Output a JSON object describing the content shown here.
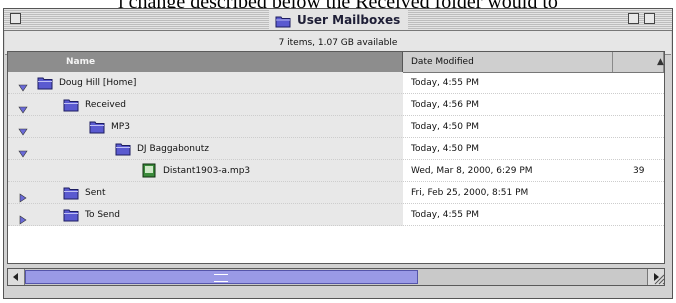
{
  "caption": "l change described below the Received folder would to",
  "window": {
    "title": "User Mailboxes"
  },
  "status": {
    "text": "7 items, 1.07 GB available"
  },
  "columns": {
    "name": "Name",
    "date": "Date Modified"
  },
  "rows": [
    {
      "label": "Doug Hill [Home]",
      "date": "Today, 4:55 PM",
      "size": "",
      "expanded": true,
      "type": "folder",
      "depth": 0
    },
    {
      "label": "Received",
      "date": "Today, 4:56 PM",
      "size": "",
      "expanded": true,
      "type": "folder",
      "depth": 1
    },
    {
      "label": "MP3",
      "date": "Today, 4:50 PM",
      "size": "",
      "expanded": true,
      "type": "folder",
      "depth": 2
    },
    {
      "label": "DJ Baggabonutz",
      "date": "Today, 4:50 PM",
      "size": "",
      "expanded": true,
      "type": "folder",
      "depth": 3
    },
    {
      "label": "Distant1903-a.mp3",
      "date": "Wed, Mar 8, 2000, 6:29 PM",
      "size": "39",
      "expanded": null,
      "type": "file",
      "depth": 4
    },
    {
      "label": "Sent",
      "date": "Fri, Feb 25, 2000, 8:51 PM",
      "size": "",
      "expanded": false,
      "type": "folder",
      "depth": 1
    },
    {
      "label": "To Send",
      "date": "Today, 4:55 PM",
      "size": "",
      "expanded": false,
      "type": "folder",
      "depth": 1
    }
  ],
  "icons": {
    "folder": "folder-icon",
    "file": "mp3-file-icon",
    "expanded": "disclosure-triangle-open-icon",
    "collapsed": "disclosure-triangle-closed-icon"
  },
  "colors": {
    "folder": "#5a5ad0",
    "triangle": "#6a6ad8",
    "scroll_thumb": "#9a9ae6",
    "file": "#3a8a3a"
  }
}
